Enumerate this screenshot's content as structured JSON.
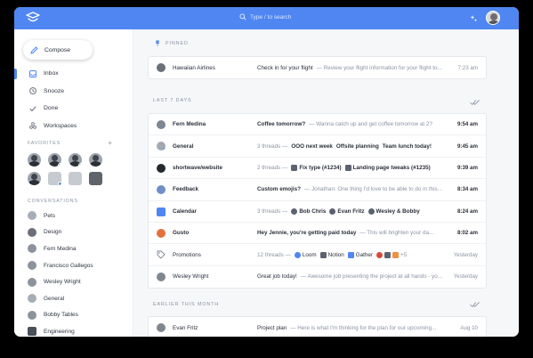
{
  "app": {
    "search_placeholder": "Type / to search",
    "accent": "#4f86f2"
  },
  "sidebar": {
    "compose_label": "Compose",
    "nav": [
      {
        "label": "Inbox",
        "icon": "inbox-icon",
        "active": true
      },
      {
        "label": "Snooze",
        "icon": "clock-icon"
      },
      {
        "label": "Done",
        "icon": "check-icon"
      },
      {
        "label": "Workspaces",
        "icon": "workspaces-icon"
      }
    ],
    "favorites_label": "FAVORITES",
    "favorites_add": "+",
    "conversations_label": "CONVERSATIONS",
    "conversations": [
      {
        "label": "Pets"
      },
      {
        "label": "Design"
      },
      {
        "label": "Fern Medina"
      },
      {
        "label": "Francisco Gallegos"
      },
      {
        "label": "Wesley Wright"
      },
      {
        "label": "General"
      },
      {
        "label": "Bobby Tables"
      },
      {
        "label": "Engineering"
      }
    ]
  },
  "main": {
    "pinned_label": "PINNED",
    "pinned": [
      {
        "sender": "Hawaiian Airlines",
        "subject": "Check in for your flight",
        "preview": "— Review your flight information for your flight to...",
        "time": "7:23 am"
      }
    ],
    "last7_label": "LAST 7 DAYS",
    "last7": [
      {
        "sender": "Fern Medina",
        "subject": "Coffee tomorrow?",
        "preview": "— Wanna catch up and get coffee tomorrow at 2?",
        "time": "9:54 am"
      },
      {
        "sender": "General",
        "meta": "3 threads —",
        "chips": [
          "OOO next week",
          "Offsite planning",
          "Team lunch today!"
        ],
        "time": "9:45 am"
      },
      {
        "sender": "shortwave/website",
        "meta": "2 threads —",
        "chips": [
          "Fix type (#1234)",
          "Landing page tweaks (#1235)"
        ],
        "time": "9:39 am"
      },
      {
        "sender": "Feedback",
        "subject": "Custom emojis?",
        "preview": "— Jonathan: One thing I'd love to be able to do in this...",
        "time": "8:34 am"
      },
      {
        "sender": "Calendar",
        "meta": "3 threads —",
        "chips": [
          "Bob Chris",
          "Evan Fritz",
          "Wesley & Bobby"
        ],
        "time": "8:24 am"
      },
      {
        "sender": "Gusto",
        "subject": "Hey Jennie, you're getting paid today",
        "preview": "— This will brighten your da...",
        "time": "8:02 am"
      },
      {
        "sender": "Promotions",
        "meta": "12 threads —",
        "chips": [
          "Loom",
          "Notion",
          "Gather"
        ],
        "extra": "+5",
        "time": "Yesterday"
      },
      {
        "sender": "Wesley Wright",
        "subject": "Great job today!",
        "preview": "— Awesome job presenting the project at all hands - yo...",
        "time": "Yesterday"
      }
    ],
    "earlier_label": "EARLIER THIS MONTH",
    "earlier": [
      {
        "sender": "Evan Fritz",
        "subject": "Project plan",
        "preview": "— Here is what I'm thinking for the plan for our upcoming...",
        "time": "Aug 10"
      }
    ]
  }
}
